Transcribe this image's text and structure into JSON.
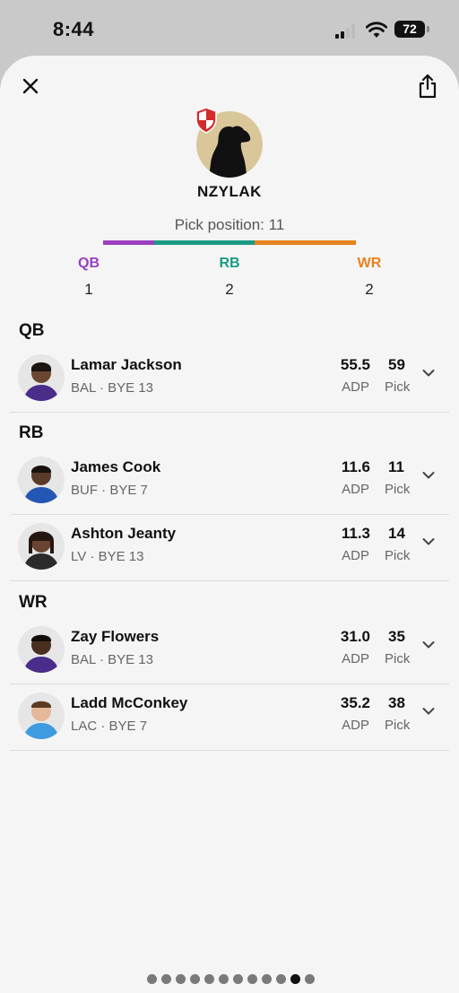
{
  "status_bar": {
    "time": "8:44",
    "battery": "72"
  },
  "header": {
    "team_name": "NZYLAK",
    "pick_position": "Pick position: 11"
  },
  "position_summary": [
    {
      "label": "QB",
      "count": "1",
      "color": "#9b3fbf"
    },
    {
      "label": "RB",
      "count": "2",
      "color": "#1a9a84"
    },
    {
      "label": "WR",
      "count": "2",
      "color": "#e7821f"
    }
  ],
  "sections": [
    {
      "title": "QB",
      "players": [
        {
          "name": "Lamar Jackson",
          "meta": "BAL · BYE 13",
          "adp": "55.5",
          "adp_label": "ADP",
          "pick": "59",
          "pick_label": "Pick"
        }
      ]
    },
    {
      "title": "RB",
      "players": [
        {
          "name": "James Cook",
          "meta": "BUF · BYE 7",
          "adp": "11.6",
          "adp_label": "ADP",
          "pick": "11",
          "pick_label": "Pick"
        },
        {
          "name": "Ashton Jeanty",
          "meta": "LV · BYE 13",
          "adp": "11.3",
          "adp_label": "ADP",
          "pick": "14",
          "pick_label": "Pick"
        }
      ]
    },
    {
      "title": "WR",
      "players": [
        {
          "name": "Zay Flowers",
          "meta": "BAL · BYE 13",
          "adp": "31.0",
          "adp_label": "ADP",
          "pick": "35",
          "pick_label": "Pick"
        },
        {
          "name": "Ladd McConkey",
          "meta": "LAC · BYE 7",
          "adp": "35.2",
          "adp_label": "ADP",
          "pick": "38",
          "pick_label": "Pick"
        }
      ]
    }
  ],
  "pager": {
    "total": 12,
    "active": 11
  }
}
